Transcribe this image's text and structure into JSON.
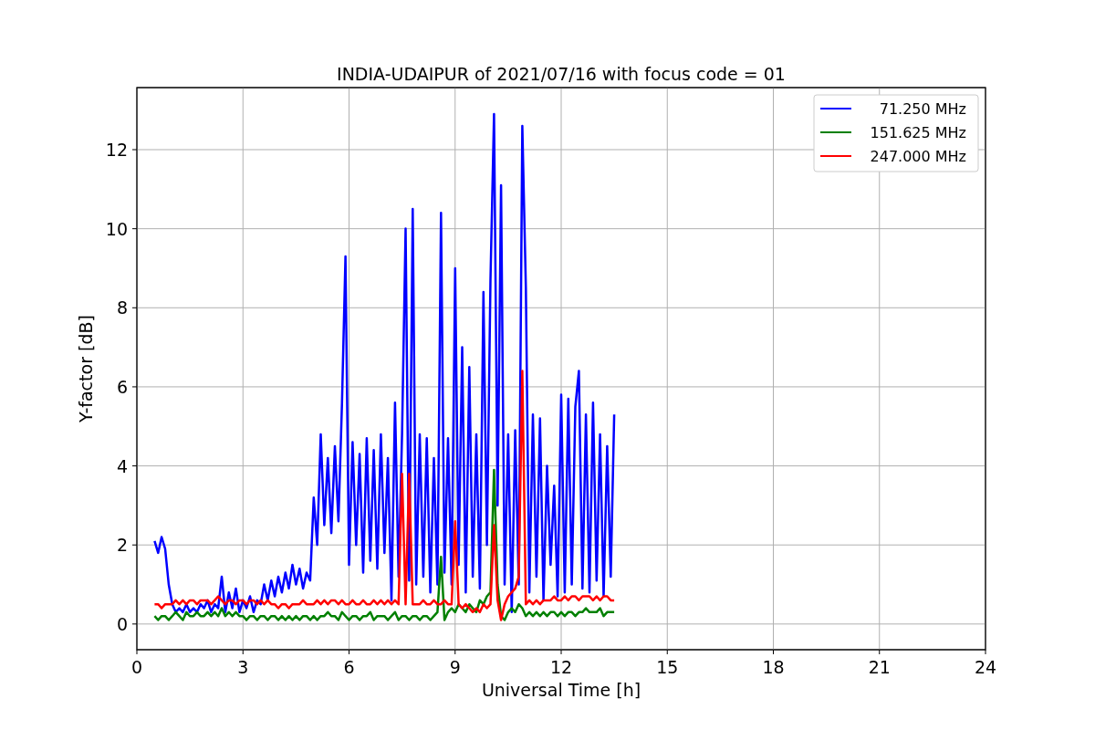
{
  "figure": {
    "chart_data": {
      "type": "line",
      "title": "INDIA-UDAIPUR of 2021/07/16 with focus code = 01",
      "xlabel": "Universal Time [h]",
      "ylabel": "Y-factor [dB]",
      "x": [
        0.5,
        0.6,
        0.7,
        0.8,
        0.9,
        1.0,
        1.1,
        1.2,
        1.3,
        1.4,
        1.5,
        1.6,
        1.7,
        1.8,
        1.9,
        2.0,
        2.1,
        2.2,
        2.3,
        2.4,
        2.5,
        2.6,
        2.7,
        2.8,
        2.9,
        3.0,
        3.1,
        3.2,
        3.3,
        3.4,
        3.5,
        3.6,
        3.7,
        3.8,
        3.9,
        4.0,
        4.1,
        4.2,
        4.3,
        4.4,
        4.5,
        4.6,
        4.7,
        4.8,
        4.9,
        5.0,
        5.1,
        5.2,
        5.3,
        5.4,
        5.5,
        5.6,
        5.7,
        5.8,
        5.9,
        6.0,
        6.1,
        6.2,
        6.3,
        6.4,
        6.5,
        6.6,
        6.7,
        6.8,
        6.9,
        7.0,
        7.1,
        7.2,
        7.3,
        7.4,
        7.5,
        7.6,
        7.7,
        7.8,
        7.9,
        8.0,
        8.1,
        8.2,
        8.3,
        8.4,
        8.5,
        8.6,
        8.7,
        8.8,
        8.9,
        9.0,
        9.1,
        9.2,
        9.3,
        9.4,
        9.5,
        9.6,
        9.7,
        9.8,
        9.9,
        10.0,
        10.1,
        10.2,
        10.3,
        10.4,
        10.5,
        10.6,
        10.7,
        10.8,
        10.9,
        11.0,
        11.1,
        11.2,
        11.3,
        11.4,
        11.5,
        11.6,
        11.7,
        11.8,
        11.9,
        12.0,
        12.1,
        12.2,
        12.3,
        12.4,
        12.5,
        12.6,
        12.7,
        12.8,
        12.9,
        13.0,
        13.1,
        13.2,
        13.3,
        13.4,
        13.5
      ],
      "series": [
        {
          "name": " 71.250 MHz",
          "color": "#0000ff",
          "values": [
            2.1,
            1.8,
            2.2,
            1.9,
            1.0,
            0.5,
            0.3,
            0.4,
            0.3,
            0.5,
            0.3,
            0.4,
            0.3,
            0.5,
            0.4,
            0.6,
            0.3,
            0.5,
            0.4,
            1.2,
            0.3,
            0.8,
            0.4,
            0.9,
            0.3,
            0.6,
            0.4,
            0.7,
            0.3,
            0.6,
            0.5,
            1.0,
            0.6,
            1.1,
            0.7,
            1.2,
            0.8,
            1.3,
            0.9,
            1.5,
            1.0,
            1.4,
            0.9,
            1.3,
            1.1,
            3.2,
            2.0,
            4.8,
            2.5,
            4.2,
            2.3,
            4.5,
            2.6,
            5.6,
            9.3,
            1.5,
            4.6,
            2.0,
            4.3,
            1.3,
            4.7,
            1.6,
            4.4,
            1.4,
            4.8,
            1.8,
            4.2,
            0.6,
            5.6,
            1.2,
            4.8,
            10.0,
            1.1,
            10.5,
            1.0,
            4.8,
            1.2,
            4.7,
            0.8,
            4.2,
            1.0,
            10.4,
            1.3,
            4.7,
            1.0,
            9.0,
            1.5,
            7.0,
            0.8,
            6.5,
            1.2,
            4.8,
            0.9,
            8.4,
            2.0,
            8.7,
            12.9,
            3.0,
            11.1,
            1.0,
            4.8,
            0.3,
            4.9,
            1.0,
            12.6,
            8.5,
            0.8,
            5.3,
            1.2,
            5.2,
            0.6,
            4.0,
            1.5,
            3.5,
            0.7,
            5.8,
            0.8,
            5.7,
            1.0,
            5.5,
            6.4,
            0.9,
            5.3,
            0.8,
            5.6,
            1.1,
            4.8,
            0.7,
            4.5,
            1.2,
            5.3
          ]
        },
        {
          "name": "151.625 MHz",
          "color": "#008000",
          "values": [
            0.2,
            0.1,
            0.2,
            0.2,
            0.1,
            0.2,
            0.3,
            0.2,
            0.1,
            0.3,
            0.2,
            0.2,
            0.3,
            0.2,
            0.2,
            0.3,
            0.2,
            0.3,
            0.2,
            0.4,
            0.2,
            0.3,
            0.2,
            0.3,
            0.2,
            0.2,
            0.1,
            0.2,
            0.2,
            0.1,
            0.2,
            0.2,
            0.1,
            0.2,
            0.2,
            0.1,
            0.2,
            0.1,
            0.2,
            0.1,
            0.2,
            0.1,
            0.2,
            0.2,
            0.1,
            0.2,
            0.1,
            0.2,
            0.2,
            0.3,
            0.2,
            0.2,
            0.1,
            0.3,
            0.2,
            0.1,
            0.2,
            0.2,
            0.1,
            0.2,
            0.2,
            0.3,
            0.1,
            0.2,
            0.2,
            0.2,
            0.1,
            0.2,
            0.3,
            0.1,
            0.2,
            0.2,
            0.1,
            0.2,
            0.2,
            0.1,
            0.2,
            0.2,
            0.1,
            0.2,
            0.3,
            1.7,
            0.1,
            0.3,
            0.4,
            0.3,
            0.5,
            0.4,
            0.3,
            0.5,
            0.4,
            0.3,
            0.6,
            0.5,
            0.7,
            0.8,
            3.9,
            1.0,
            0.2,
            0.1,
            0.3,
            0.4,
            0.3,
            0.5,
            0.4,
            0.2,
            0.3,
            0.2,
            0.3,
            0.2,
            0.3,
            0.2,
            0.3,
            0.3,
            0.2,
            0.3,
            0.2,
            0.3,
            0.3,
            0.2,
            0.3,
            0.3,
            0.4,
            0.3,
            0.3,
            0.3,
            0.4,
            0.2,
            0.3,
            0.3,
            0.3
          ]
        },
        {
          "name": "247.000 MHz",
          "color": "#ff0000",
          "values": [
            0.5,
            0.5,
            0.4,
            0.5,
            0.5,
            0.5,
            0.6,
            0.5,
            0.6,
            0.5,
            0.6,
            0.6,
            0.5,
            0.6,
            0.6,
            0.6,
            0.5,
            0.6,
            0.7,
            0.6,
            0.5,
            0.6,
            0.6,
            0.5,
            0.6,
            0.6,
            0.5,
            0.6,
            0.6,
            0.5,
            0.6,
            0.5,
            0.6,
            0.5,
            0.5,
            0.4,
            0.5,
            0.5,
            0.4,
            0.5,
            0.5,
            0.5,
            0.6,
            0.5,
            0.5,
            0.5,
            0.6,
            0.5,
            0.6,
            0.5,
            0.6,
            0.6,
            0.5,
            0.6,
            0.5,
            0.5,
            0.6,
            0.5,
            0.5,
            0.6,
            0.5,
            0.5,
            0.6,
            0.5,
            0.6,
            0.5,
            0.6,
            0.5,
            0.6,
            0.5,
            3.8,
            0.5,
            3.8,
            0.5,
            0.5,
            0.5,
            0.6,
            0.5,
            0.5,
            0.6,
            0.5,
            0.5,
            0.6,
            0.5,
            0.5,
            2.6,
            0.5,
            0.4,
            0.5,
            0.4,
            0.3,
            0.4,
            0.3,
            0.5,
            0.4,
            0.5,
            2.5,
            0.6,
            0.1,
            0.5,
            0.7,
            0.8,
            0.9,
            1.2,
            6.4,
            0.5,
            0.6,
            0.5,
            0.6,
            0.5,
            0.6,
            0.6,
            0.6,
            0.7,
            0.6,
            0.6,
            0.7,
            0.6,
            0.7,
            0.7,
            0.6,
            0.7,
            0.7,
            0.7,
            0.6,
            0.7,
            0.6,
            0.7,
            0.7,
            0.6,
            0.6
          ]
        }
      ],
      "xlim": [
        0,
        24
      ],
      "ylim": [
        -0.65,
        13.57
      ],
      "xticks": [
        0,
        3,
        6,
        9,
        12,
        15,
        18,
        21,
        24
      ],
      "yticks": [
        0,
        2,
        4,
        6,
        8,
        10,
        12
      ],
      "grid": true,
      "legend": true
    }
  }
}
